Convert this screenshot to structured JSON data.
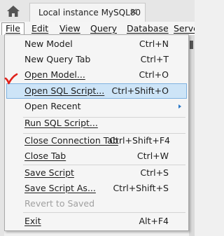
{
  "tab": {
    "label": "Local instance MySQL80",
    "close": "×"
  },
  "menubar": {
    "items": [
      "File",
      "Edit",
      "View",
      "Query",
      "Database",
      "Server"
    ]
  },
  "file_menu": {
    "items": [
      {
        "label": "New Model",
        "shortcut": "Ctrl+N"
      },
      {
        "label": "New Query Tab",
        "shortcut": "Ctrl+T"
      },
      {
        "label": "Open Model...",
        "shortcut": "Ctrl+O"
      },
      {
        "label": "Open SQL Script...",
        "shortcut": "Ctrl+Shift+O",
        "highlighted": true
      },
      {
        "label": "Open Recent",
        "shortcut": "",
        "submenu": true
      },
      {
        "label": "Run SQL Script...",
        "shortcut": ""
      },
      {
        "label": "Close Connection Tab",
        "shortcut": "Ctrl+Shift+F4"
      },
      {
        "label": "Close Tab",
        "shortcut": "Ctrl+W"
      },
      {
        "label": "Save Script",
        "shortcut": "Ctrl+S"
      },
      {
        "label": "Save Script As...",
        "shortcut": "Ctrl+Shift+S"
      },
      {
        "label": "Revert to Saved",
        "shortcut": "",
        "disabled": true
      },
      {
        "label": "Exit",
        "shortcut": "Alt+F4"
      }
    ]
  },
  "colors": {
    "highlight_bg": "#cde4f7",
    "highlight_border": "#7fb2e0",
    "annotation_check": "#e0231c",
    "submenu_arrow": "#2a78c7"
  },
  "icons": {
    "home": "home-icon",
    "annotation": "red-checkmark-icon",
    "submenu": "submenu-arrow-icon"
  }
}
